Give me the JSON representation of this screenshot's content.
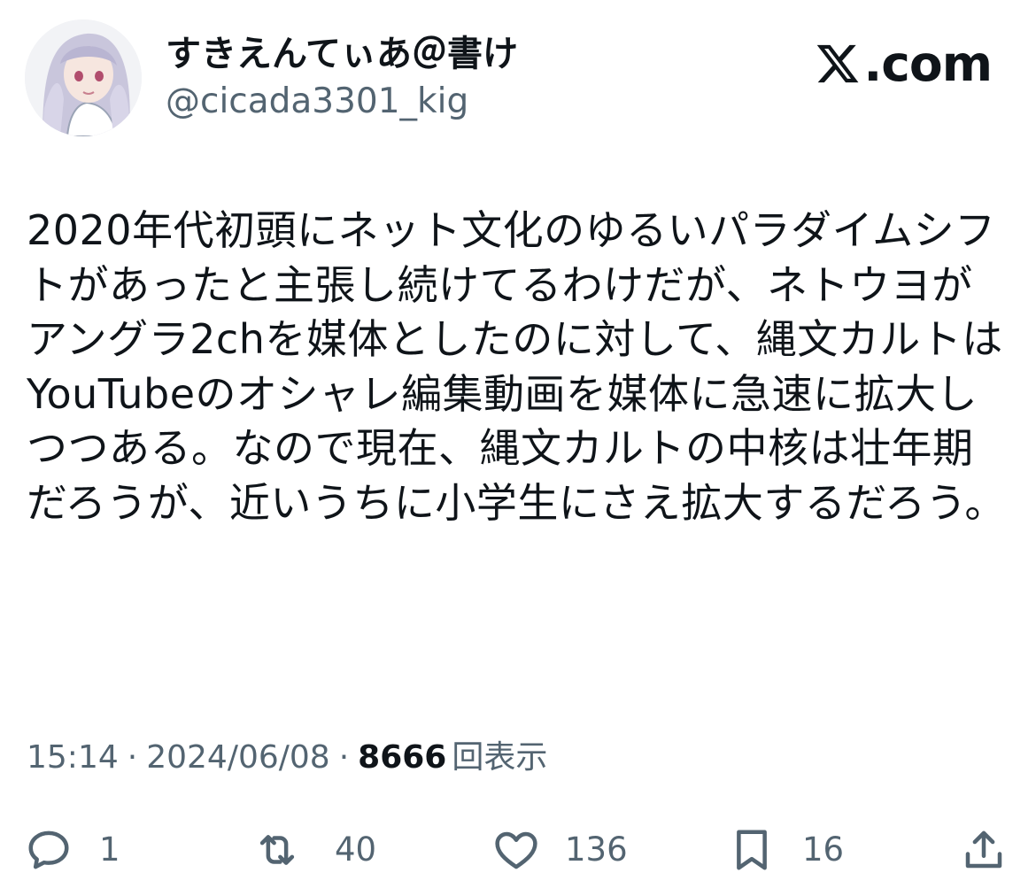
{
  "author": {
    "display_name": "すきえんてぃあ＠書け",
    "handle": "@cicada3301_kig",
    "avatar_icon": "avatar-icon"
  },
  "brand": {
    "label": ".com",
    "icon": "x-logo-icon"
  },
  "post": {
    "text": "2020年代初頭にネット文化のゆるいパラダイムシフトがあったと主張し続けてるわけだが、ネトウヨがアングラ2chを媒体としたのに対して、縄文カルトはYouTubeのオシャレ編集動画を媒体に急速に拡大しつつある。なので現在、縄文カルトの中核は壮年期だろうが、近いうちに小学生にさえ拡大するだろう。"
  },
  "meta": {
    "time": "15:14",
    "separator": "·",
    "date": "2024/06/08",
    "views": "8666",
    "views_label": "回表示"
  },
  "actions": {
    "reply_count": "1",
    "repost_count": "40",
    "like_count": "136",
    "bookmark_count": "16"
  },
  "colors": {
    "text_primary": "#0f1419",
    "text_secondary": "#536471",
    "background": "#ffffff"
  }
}
